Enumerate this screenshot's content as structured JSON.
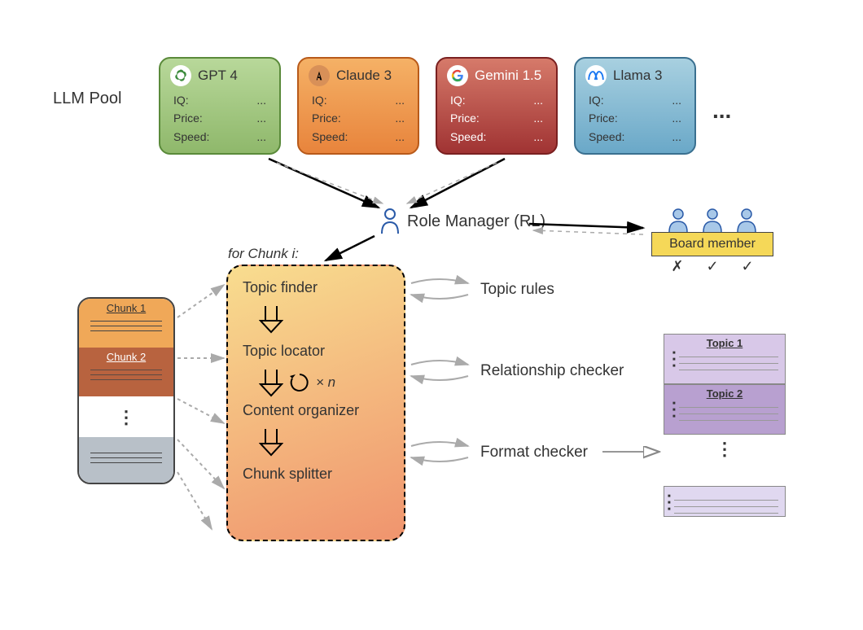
{
  "pool_label": "LLM Pool",
  "llms": [
    {
      "name": "GPT 4",
      "icon": "openai",
      "props": {
        "iq_label": "IQ:",
        "iq": "...",
        "price_label": "Price:",
        "price": "...",
        "speed_label": "Speed:",
        "speed": "..."
      }
    },
    {
      "name": "Claude 3",
      "icon": "anthropic",
      "props": {
        "iq_label": "IQ:",
        "iq": "...",
        "price_label": "Price:",
        "price": "...",
        "speed_label": "Speed:",
        "speed": "..."
      }
    },
    {
      "name": "Gemini 1.5",
      "icon": "google",
      "props": {
        "iq_label": "IQ:",
        "iq": "...",
        "price_label": "Price:",
        "price": "...",
        "speed_label": "Speed:",
        "speed": "..."
      }
    },
    {
      "name": "Llama 3",
      "icon": "meta",
      "props": {
        "iq_label": "IQ:",
        "iq": "...",
        "price_label": "Price:",
        "price": "...",
        "speed_label": "Speed:",
        "speed": "..."
      }
    }
  ],
  "pool_more": "...",
  "role_manager": "Role Manager (RL)",
  "chunk_loop_label": "for Chunk i:",
  "chunks": {
    "c1": "Chunk 1",
    "c2": "Chunk 2"
  },
  "process": {
    "p1": "Topic finder",
    "p2": "Topic locator",
    "p3": "Content organizer",
    "p4": "Chunk splitter",
    "loop_times": "× n"
  },
  "checkers": {
    "c1": "Topic rules",
    "c2": "Relationship checker",
    "c3": "Format checker"
  },
  "board": {
    "label": "Board member",
    "votes": [
      "✗",
      "✓",
      "✓"
    ]
  },
  "topics": {
    "t1": "Topic 1",
    "t2": "Topic 2"
  },
  "vdots": "⋮"
}
